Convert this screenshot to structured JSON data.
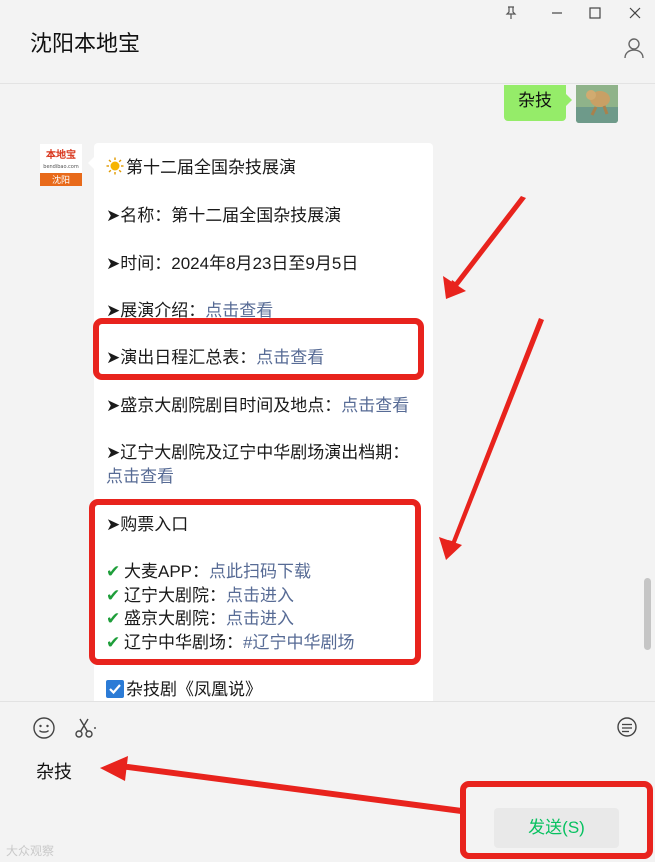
{
  "window": {
    "title": "沈阳本地宝",
    "pin_icon": "pin-icon",
    "minimize_icon": "minimize-icon",
    "maximize_icon": "maximize-icon",
    "close_icon": "close-icon",
    "profile_icon": "person-icon"
  },
  "chat": {
    "my_message": "杂技",
    "their_avatar": {
      "top": "本地宝",
      "sub": "bendibao.com",
      "bottom": "沈阳"
    },
    "card": {
      "title": "第十二届全国杂技展演",
      "items": [
        {
          "prefix": "➤",
          "text": "名称：第十二届全国杂技展演"
        },
        {
          "prefix": "➤",
          "text": "时间：2024年8月23日至9月5日"
        },
        {
          "prefix": "➤",
          "text": "展演介绍：",
          "link": "点击查看"
        },
        {
          "prefix": "➤",
          "text": "演出日程汇总表：",
          "link": "点击查看"
        },
        {
          "prefix": "➤",
          "text": "盛京大剧院剧目时间及地点：",
          "link": "点击查看"
        },
        {
          "prefix": "➤",
          "text": "辽宁大剧院及辽宁中华剧场演出档期：",
          "link": "点击查看"
        }
      ],
      "ticket_header": "➤购票入口",
      "ticket_items": [
        {
          "label": "大麦APP：",
          "link": "点此扫码下载"
        },
        {
          "label": "辽宁大剧院：",
          "link": "点击进入"
        },
        {
          "label": "盛京大剧院：",
          "link": "点击进入"
        },
        {
          "label": "辽宁中华剧场：",
          "link": "#辽宁中华剧场"
        }
      ],
      "last_item": "杂技剧《凤凰说》"
    }
  },
  "input": {
    "value": "杂技",
    "emoji_icon": "emoji-icon",
    "scissors_icon": "scissors-icon",
    "chat_bubble_icon": "chat-bubble-icon",
    "send_label": "发送(S)"
  },
  "watermark": "大众观察",
  "colors": {
    "link": "#576b95",
    "my_bubble": "#95ec69",
    "send_text": "#07c160",
    "annotation_red": "#e8231d"
  }
}
